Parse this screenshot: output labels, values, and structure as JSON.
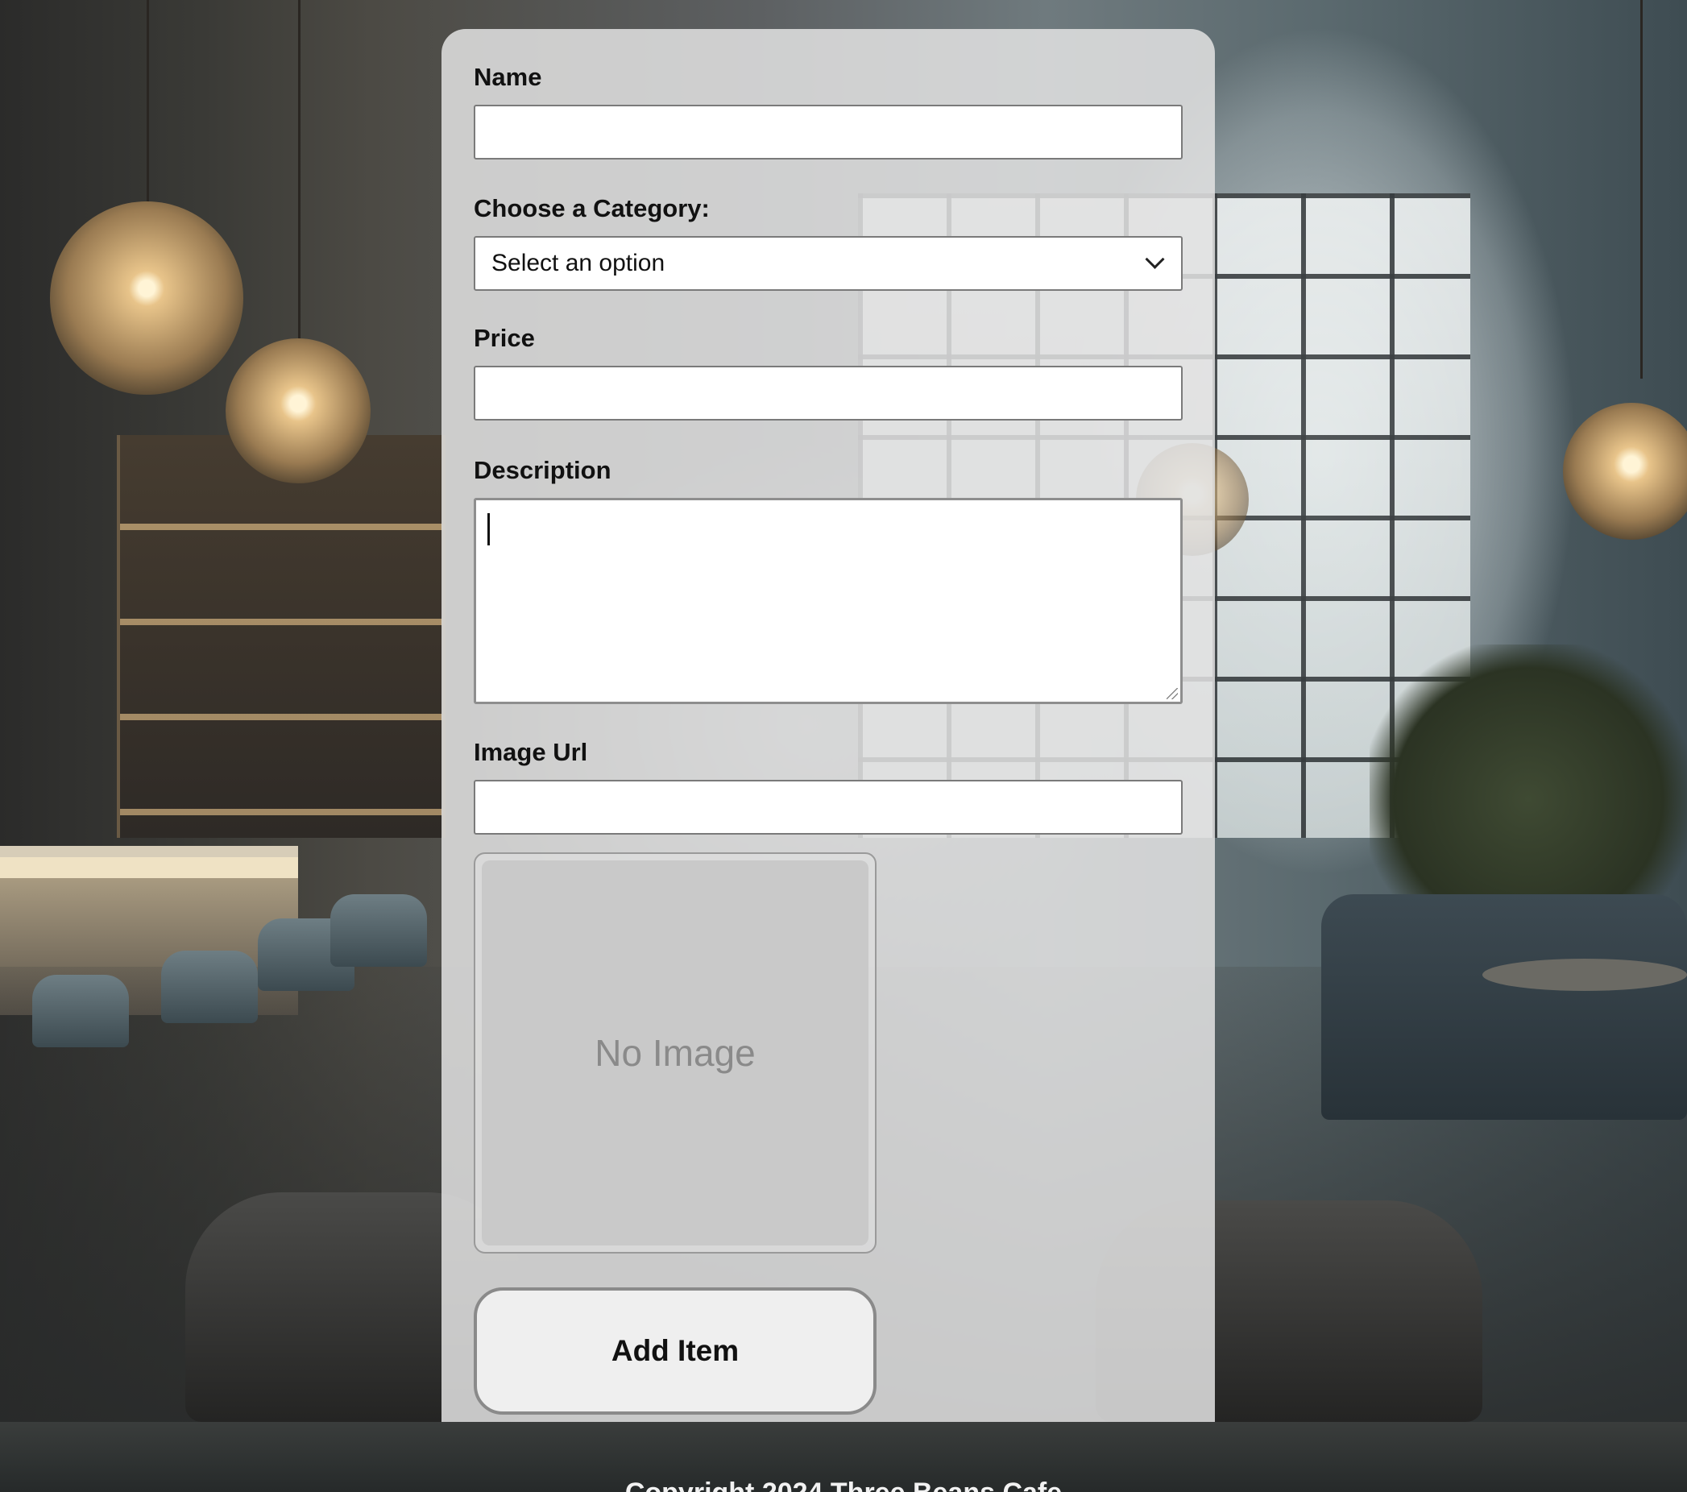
{
  "form": {
    "name": {
      "label": "Name",
      "value": ""
    },
    "category": {
      "label": "Choose a Category:",
      "selected": "Select an option"
    },
    "price": {
      "label": "Price",
      "value": ""
    },
    "description": {
      "label": "Description",
      "value": ""
    },
    "image_url": {
      "label": "Image Url",
      "value": ""
    },
    "preview": {
      "placeholder": "No Image"
    },
    "submit_label": "Add Item"
  },
  "footer": {
    "text": "Copyright 2024 Three Beans Cafe"
  },
  "icons": {
    "select_arrow": "chevron-down-icon"
  },
  "colors": {
    "card_bg": "#e2e2e2",
    "field_border": "#7a7a7a",
    "preview_bg": "#c9c9c9"
  }
}
